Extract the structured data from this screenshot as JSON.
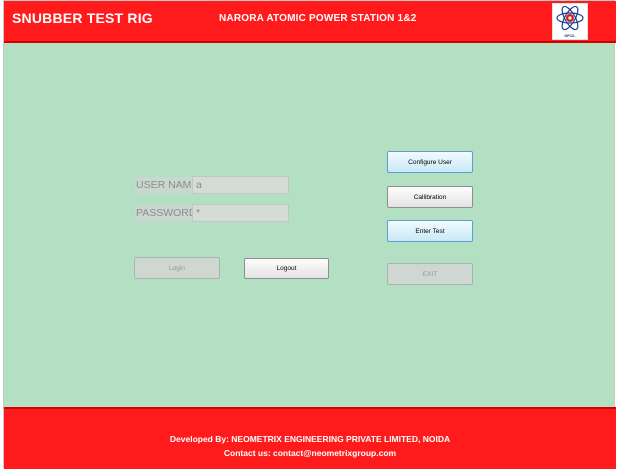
{
  "header": {
    "app_title": "SNUBBER TEST RIG",
    "station_title": "NARORA ATOMIC POWER STATION 1&2",
    "logo_text": "NPCIL"
  },
  "login": {
    "username_label": "USER NAME",
    "username_value": "a",
    "password_label": "PASSWORD",
    "password_value": "*",
    "login_label": "Login",
    "logout_label": "Logout"
  },
  "actions": {
    "configure_user_label": "Configure User",
    "calibration_label": "Callibration",
    "enter_test_label": "Enter Test",
    "exit_label": "EXIT"
  },
  "footer": {
    "developed_by": "Developed By: NEOMETRIX ENGINEERING PRIVATE LIMITED, NOIDA",
    "contact": "Contact us: contact@neometrixgroup.com"
  },
  "colors": {
    "header_red": "#ff1b1b",
    "body_green": "#b3dfc2",
    "active_button_blue": "#c9e8f7"
  }
}
